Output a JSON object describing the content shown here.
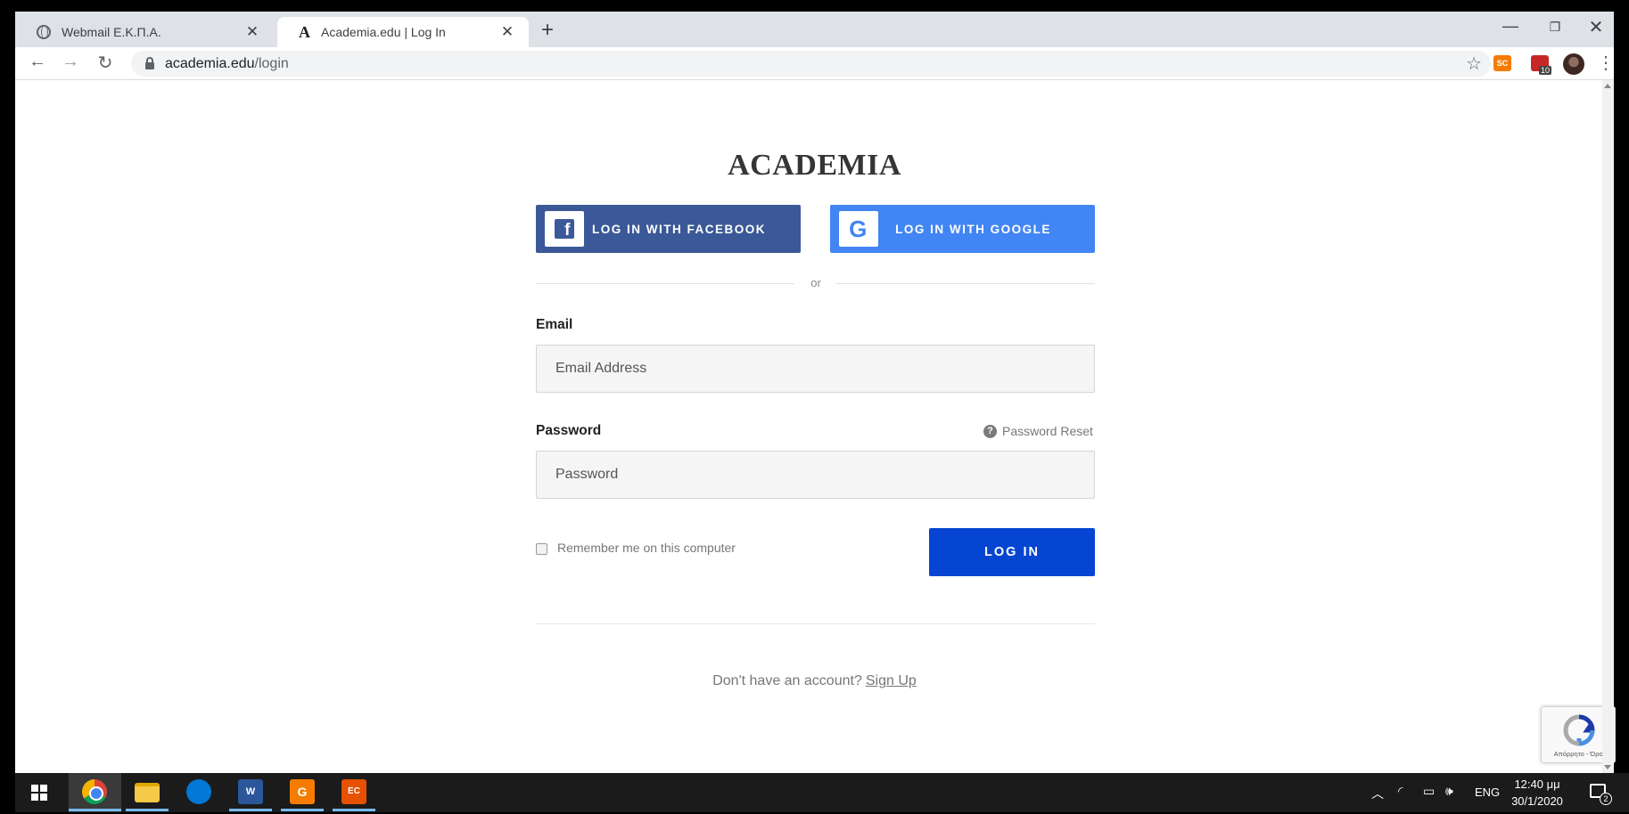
{
  "browser": {
    "tabs": [
      {
        "title": "Webmail Ε.Κ.Π.Α.",
        "close": "✕"
      },
      {
        "title": "Academia.edu | Log In",
        "close": "✕"
      }
    ],
    "new_tab": "+",
    "url_host": "academia.edu",
    "url_path": "/login",
    "extension_sc": "SC",
    "extension_badge": "10"
  },
  "page": {
    "logo": "ACADEMIA",
    "facebook_label": "LOG IN WITH FACEBOOK",
    "google_label": "LOG IN WITH GOOGLE",
    "or_text": "or",
    "email_label": "Email",
    "email_placeholder": "Email Address",
    "password_label": "Password",
    "password_placeholder": "Password",
    "password_reset": "Password Reset",
    "remember_label": "Remember me on this computer",
    "login_label": "LOG IN",
    "signup_prompt": "Don't have an account?",
    "signup_link": "Sign Up",
    "recaptcha_text": "Απόρρητο - Όροι"
  },
  "taskbar": {
    "language": "ENG",
    "time": "12:40 μμ",
    "date": "30/1/2020",
    "notifications": "2",
    "apps": [
      "chrome-icon",
      "file-explorer-icon",
      "outlook-icon",
      "word-icon",
      "g-app-icon",
      "app-icon"
    ]
  },
  "colors": {
    "facebook": "#3b5998",
    "google": "#4285f4",
    "login": "#0645d1"
  }
}
